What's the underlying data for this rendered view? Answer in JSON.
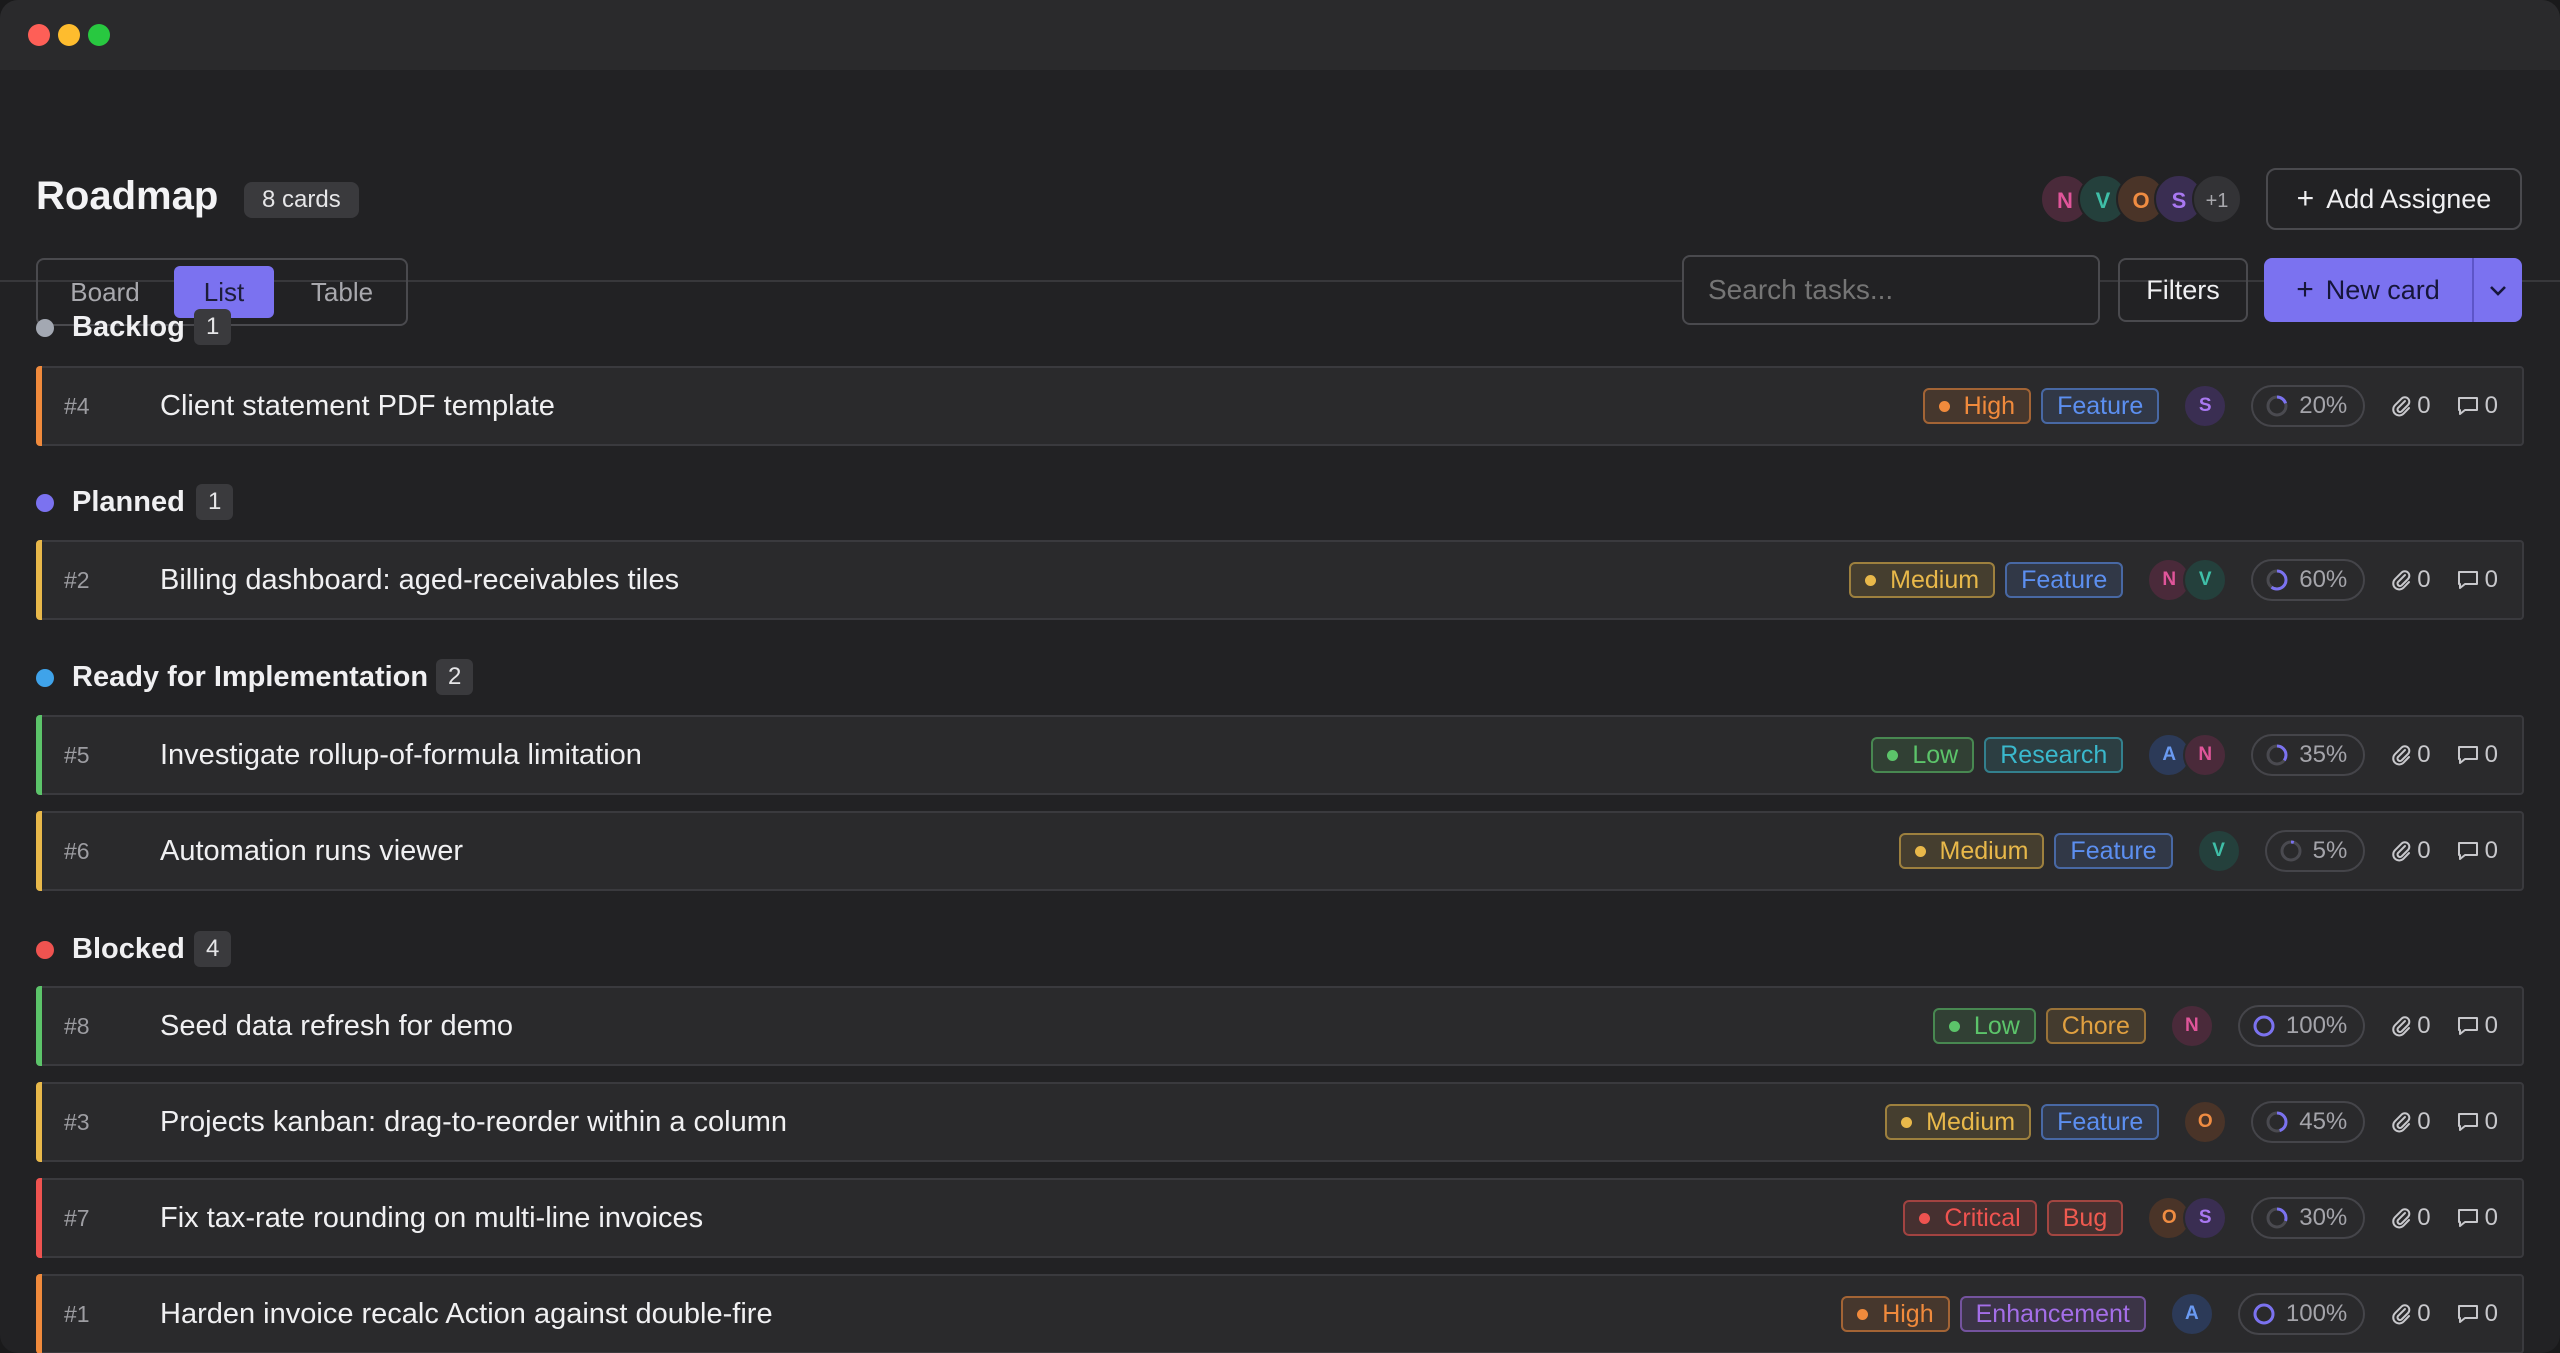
{
  "header": {
    "title": "Roadmap",
    "card_count": "8 cards",
    "assignees": [
      {
        "initial": "N",
        "color": "#e0559a",
        "bg": "#4a2a3a"
      },
      {
        "initial": "V",
        "color": "#3fbfa8",
        "bg": "#24403c"
      },
      {
        "initial": "O",
        "color": "#ef8c42",
        "bg": "#4a3428"
      },
      {
        "initial": "S",
        "color": "#a978f2",
        "bg": "#3a2e52"
      }
    ],
    "assignee_overflow": "+1",
    "add_assignee_label": "Add Assignee"
  },
  "view_tabs": [
    {
      "label": "Board",
      "active": false
    },
    {
      "label": "List",
      "active": true
    },
    {
      "label": "Table",
      "active": false
    }
  ],
  "search": {
    "placeholder": "Search tasks..."
  },
  "filters_label": "Filters",
  "new_card_label": "New card",
  "accent_color": "#7b72f0",
  "groups": [
    {
      "name": "Backlog",
      "count": "1",
      "dot_color": "#a3a8b2"
    },
    {
      "name": "Planned",
      "count": "1",
      "dot_color": "#7b72f0"
    },
    {
      "name": "Ready for Implementation",
      "count": "2",
      "dot_color": "#3fa3ea"
    },
    {
      "name": "Blocked",
      "count": "4",
      "dot_color": "#ef5350"
    }
  ],
  "cards": [
    {
      "id": "#4",
      "title": "Client statement PDF template",
      "priority": "High",
      "type": "Feature",
      "assignees": [
        "S"
      ],
      "progress": "20%",
      "attachments": "0",
      "comments": "0"
    },
    {
      "id": "#2",
      "title": "Billing dashboard: aged-receivables tiles",
      "priority": "Medium",
      "type": "Feature",
      "assignees": [
        "N",
        "V"
      ],
      "progress": "60%",
      "attachments": "0",
      "comments": "0"
    },
    {
      "id": "#5",
      "title": "Investigate rollup-of-formula limitation",
      "priority": "Low",
      "type": "Research",
      "assignees": [
        "A",
        "N"
      ],
      "progress": "35%",
      "attachments": "0",
      "comments": "0"
    },
    {
      "id": "#6",
      "title": "Automation runs viewer",
      "priority": "Medium",
      "type": "Feature",
      "assignees": [
        "V"
      ],
      "progress": "5%",
      "attachments": "0",
      "comments": "0"
    },
    {
      "id": "#8",
      "title": "Seed data refresh for demo",
      "priority": "Low",
      "type": "Chore",
      "assignees": [
        "N"
      ],
      "progress": "100%",
      "attachments": "0",
      "comments": "0"
    },
    {
      "id": "#3",
      "title": "Projects kanban: drag-to-reorder within a column",
      "priority": "Medium",
      "type": "Feature",
      "assignees": [
        "O"
      ],
      "progress": "45%",
      "attachments": "0",
      "comments": "0"
    },
    {
      "id": "#7",
      "title": "Fix tax-rate rounding on multi-line invoices",
      "priority": "Critical",
      "type": "Bug",
      "assignees": [
        "O",
        "S"
      ],
      "progress": "30%",
      "attachments": "0",
      "comments": "0"
    },
    {
      "id": "#1",
      "title": "Harden invoice recalc Action against double-fire",
      "priority": "High",
      "type": "Enhancement",
      "assignees": [
        "A"
      ],
      "progress": "100%",
      "attachments": "0",
      "comments": "0"
    }
  ],
  "priority_colors": {
    "Critical": "#ef5350",
    "High": "#f08a3c",
    "Medium": "#e8b84a",
    "Low": "#5cc46a"
  },
  "type_colors": {
    "Feature": "#5c8ff0",
    "Research": "#3ab8cc",
    "Chore": "#e0a040",
    "Bug": "#ef5a50",
    "Enhancement": "#a46ee8"
  },
  "assignee_colors": {
    "N": {
      "color": "#e0559a",
      "bg": "#4a2a3a"
    },
    "V": {
      "color": "#3fbfa8",
      "bg": "#24403c"
    },
    "O": {
      "color": "#ef8c42",
      "bg": "#4a3428"
    },
    "S": {
      "color": "#a978f2",
      "bg": "#3a2e52"
    },
    "A": {
      "color": "#6a9af2",
      "bg": "#2c3a58"
    }
  }
}
